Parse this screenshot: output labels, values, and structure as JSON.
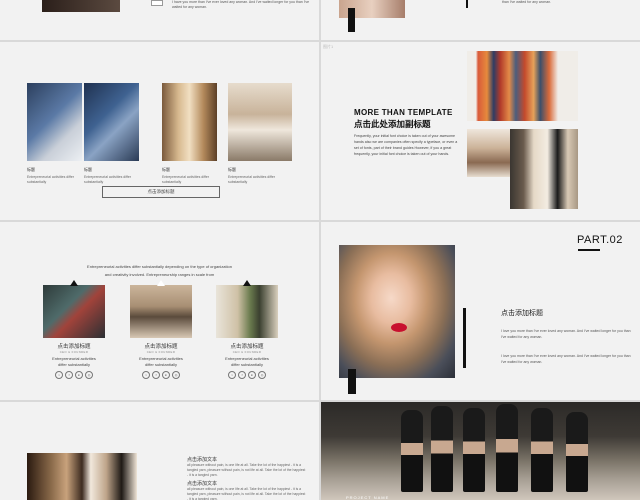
{
  "slide1": {
    "caption": "I have you more than I've ever loved any woman. And I've waited longer for you than I've waited for any woman."
  },
  "slide2": {
    "caption": "than I've waited for any woman."
  },
  "slide3": {
    "items": [
      {
        "label": "标题",
        "desc": "Entrepreneurial activities differ substantially"
      },
      {
        "label": "标题",
        "desc": "Entrepreneurial activities differ substantially"
      },
      {
        "label": "标题",
        "desc": "Entrepreneurial activities differ substantially"
      },
      {
        "label": "标题",
        "desc": "Entrepreneurial activities differ substantially"
      }
    ],
    "button": "点击添加标题"
  },
  "slide4": {
    "watermark": "图片1",
    "heading_en": "MORE THAN TEMPLATE",
    "heading_cn": "点击此处添加副标题",
    "body": "Frequently, your initial font choice is taken out of your awesome hands also we are companies often specify a typeface, or even a set of fonts, part of their brand guides However, if you a great frequently, your initial font choice is taken out of your hands."
  },
  "slide5": {
    "intro_line1": "Entrepreneurial activities differ substantially depending on the type of organization",
    "intro_line2": "and creativity involved. Entrepreneurship ranges in scale from",
    "cards": [
      {
        "title": "点击添加标题",
        "sub": "CEO & FOUNDER",
        "desc1": "Entrepreneurial activities",
        "desc2": "differ substantially"
      },
      {
        "title": "点击添加标题",
        "sub": "CEO & FOUNDER",
        "desc1": "Entrepreneurial activities",
        "desc2": "differ substantially"
      },
      {
        "title": "点击添加标题",
        "sub": "CEO & FOUNDER",
        "desc1": "Entrepreneurial activities",
        "desc2": "differ substantially"
      }
    ],
    "social_icons": [
      "twitter-icon",
      "facebook-icon",
      "linkedin-icon",
      "instagram-icon"
    ]
  },
  "slide6": {
    "part": "PART.02",
    "title": "点击添加标题",
    "p1": "I love you more than I've ever loved any woman. And I've waited longer for you than I've waited for any woman.",
    "p2": "I love you more than I've ever loved any woman. And I've waited longer for you than I've waited for any woman."
  },
  "slide7": {
    "title1": "点击添加文本",
    "p1": "all pleasure without pain, is one life at all. Take the lot of the happiest - it is a tangled yarn, pleasure without pain, is not life at all. Take the lot of the happiest - it is a tangled yarn.",
    "title2": "点击添加文本",
    "p2": "all pleasure without pain, is one life at all. Take the lot of the happiest - it is a tangled yarn, pleasure without pain, is not life at all. Take the lot of the happiest - it is a tangled yarn."
  },
  "slide8": {
    "caption": "PROJECT NAME"
  },
  "colors": {
    "accent": "#111111",
    "slide_bg": "#f2f2f2",
    "page_bg": "#d9d9d9",
    "lips": "#c8102e"
  }
}
